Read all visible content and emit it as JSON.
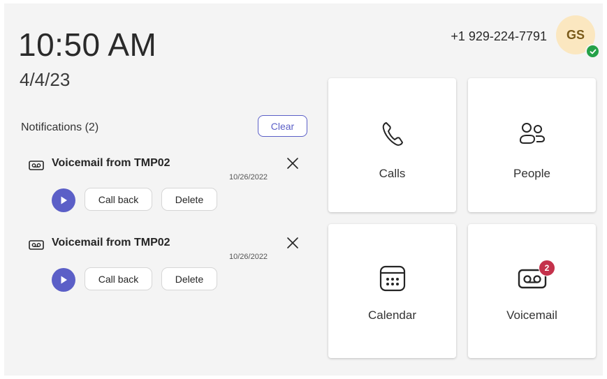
{
  "header": {
    "time": "10:50 AM",
    "date": "4/4/23",
    "phone_number": "+1 929-224-7791",
    "avatar_initials": "GS",
    "presence_icon": "check-icon",
    "presence_color": "#24a148"
  },
  "notifications": {
    "title": "Notifications (2)",
    "clear_label": "Clear",
    "items": [
      {
        "icon": "voicemail-icon",
        "title": "Voicemail from TMP02",
        "date": "10/26/2022",
        "call_back_label": "Call back",
        "delete_label": "Delete"
      },
      {
        "icon": "voicemail-icon",
        "title": "Voicemail from TMP02",
        "date": "10/26/2022",
        "call_back_label": "Call back",
        "delete_label": "Delete"
      }
    ]
  },
  "tiles": {
    "calls": {
      "label": "Calls",
      "icon": "phone-icon"
    },
    "people": {
      "label": "People",
      "icon": "people-icon"
    },
    "calendar": {
      "label": "Calendar",
      "icon": "calendar-icon"
    },
    "voicemail": {
      "label": "Voicemail",
      "icon": "voicemail-icon",
      "badge": "2"
    }
  },
  "colors": {
    "accent": "#5b5fc7",
    "badge": "#c4314b",
    "background": "#f4f4f4"
  }
}
